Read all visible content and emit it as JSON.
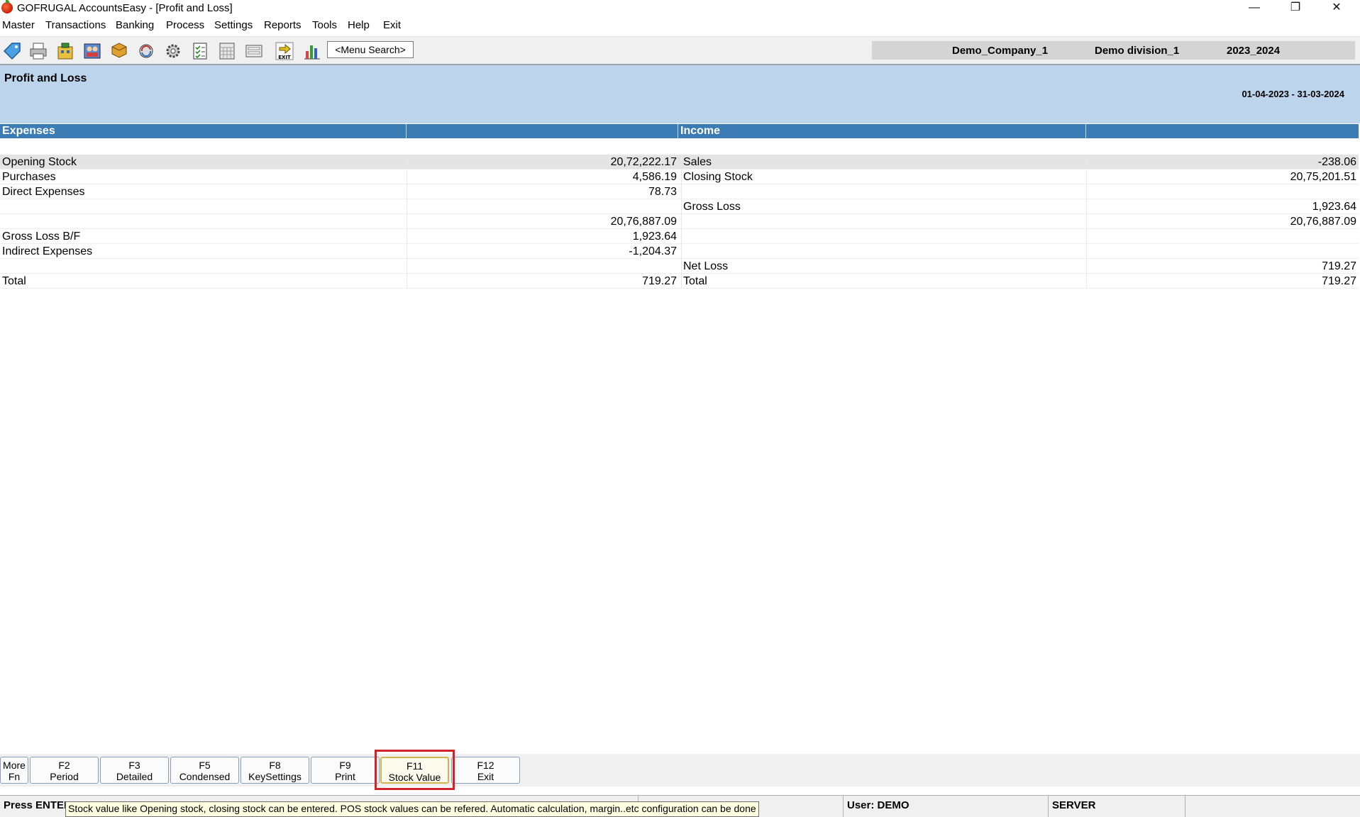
{
  "window": {
    "title": "GOFRUGAL AccountsEasy - [Profit and Loss]",
    "controls": {
      "minimize": "—",
      "restore": "❐",
      "close": "✕"
    }
  },
  "menu": [
    {
      "label": "Master"
    },
    {
      "label": "Transactions"
    },
    {
      "label": "Banking"
    },
    {
      "label": "Process"
    },
    {
      "label": "Settings"
    },
    {
      "label": "Reports"
    },
    {
      "label": "Tools"
    },
    {
      "label": "Help"
    },
    {
      "label": "Exit"
    }
  ],
  "toolbar": {
    "icons": [
      "tag-icon",
      "printer-icon",
      "building-icon",
      "people-icon",
      "stack-icon",
      "refresh-icon",
      "settings-icon",
      "checklist-icon",
      "calculator-icon",
      "form-icon",
      "exit-icon",
      "bar-chart-icon"
    ],
    "exit_icon_label": "EXIT",
    "menu_search": "<Menu Search>",
    "company": "Demo_Company_1",
    "division": "Demo division_1",
    "year": "2023_2024"
  },
  "report": {
    "title": "Profit and Loss",
    "period": "01-04-2023 - 31-03-2024",
    "headers": {
      "expenses": "Expenses",
      "income": "Income"
    },
    "rows": [
      {
        "exp_label": "Opening Stock",
        "exp_value": "20,72,222.17",
        "inc_label": "Sales",
        "inc_value": "-238.06"
      },
      {
        "exp_label": "Purchases",
        "exp_value": "4,586.19",
        "inc_label": "Closing Stock",
        "inc_value": "20,75,201.51"
      },
      {
        "exp_label": "Direct Expenses",
        "exp_value": "78.73",
        "inc_label": "",
        "inc_value": ""
      },
      {
        "exp_label": "",
        "exp_value": "",
        "inc_label": "Gross Loss",
        "inc_value": "1,923.64"
      },
      {
        "exp_label": "",
        "exp_value": "20,76,887.09",
        "inc_label": "",
        "inc_value": "20,76,887.09"
      },
      {
        "exp_label": "Gross Loss B/F",
        "exp_value": "1,923.64",
        "inc_label": "",
        "inc_value": ""
      },
      {
        "exp_label": "Indirect Expenses",
        "exp_value": "-1,204.37",
        "inc_label": "",
        "inc_value": ""
      },
      {
        "exp_label": "",
        "exp_value": "",
        "inc_label": "Net Loss",
        "inc_value": "719.27"
      },
      {
        "exp_label": "Total",
        "exp_value": "719.27",
        "inc_label": "Total",
        "inc_value": "719.27"
      }
    ]
  },
  "fkeys": [
    {
      "key": "More",
      "label": "Fn"
    },
    {
      "key": "F2",
      "label": "Period"
    },
    {
      "key": "F3",
      "label": "Detailed"
    },
    {
      "key": "F5",
      "label": "Condensed"
    },
    {
      "key": "F8",
      "label": "KeySettings"
    },
    {
      "key": "F9",
      "label": "Print"
    },
    {
      "key": "F11",
      "label": "Stock Value"
    },
    {
      "key": "F12",
      "label": "Exit"
    }
  ],
  "status": {
    "message": "Press ENTER",
    "user": "User: DEMO",
    "server": "SERVER"
  },
  "tooltip": "Stock value like Opening stock, closing stock can be entered. POS stock values can be refered. Automatic calculation, margin..etc configuration can be done"
}
